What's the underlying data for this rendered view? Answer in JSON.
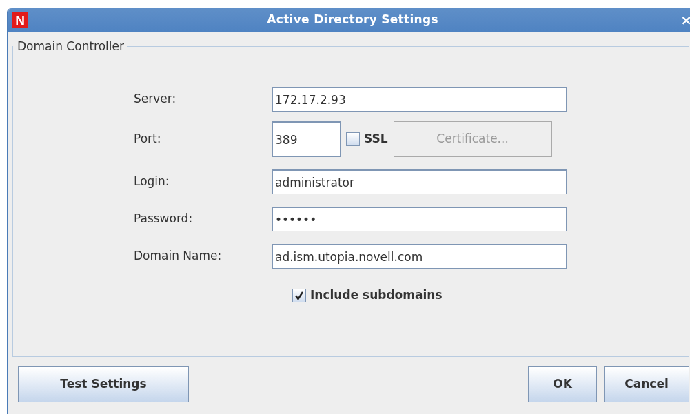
{
  "window": {
    "title": "Active Directory Settings",
    "close": "×",
    "logo": "N"
  },
  "group": {
    "title": "Domain Controller"
  },
  "server": {
    "label": "Server:",
    "value": "172.17.2.93"
  },
  "port": {
    "label": "Port:",
    "value": "389"
  },
  "ssl": {
    "label": "SSL",
    "checked": false
  },
  "certificate": {
    "label": "Certificate...",
    "disabled": true
  },
  "login": {
    "label": "Login:",
    "value": "administrator"
  },
  "password": {
    "label": "Password:",
    "value": "••••••"
  },
  "domain": {
    "label": "Domain Name:",
    "value": "ad.ism.utopia.novell.com"
  },
  "include_subdomains": {
    "label": "Include subdomains",
    "checked": true
  },
  "buttons": [
    {
      "label": "Test Settings",
      "kind": "left"
    },
    {
      "label": "OK",
      "kind": "right"
    },
    {
      "label": "Cancel",
      "kind": "right"
    }
  ]
}
